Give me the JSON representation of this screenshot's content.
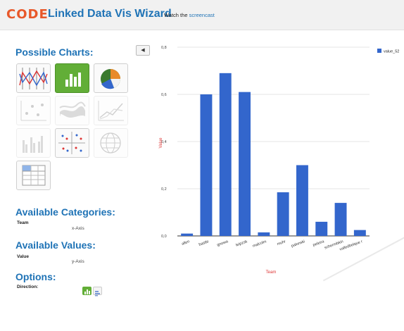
{
  "header": {
    "logo": "CODE",
    "title": "Linked Data Vis Wizard",
    "watch_prefix": "Watch the",
    "watch_link": "screencast"
  },
  "sidebar": {
    "possible_charts_title": "Possible Charts:",
    "collapse_icon": "chevron-left-icon",
    "chart_icons": [
      {
        "name": "parallel-coordinates-icon",
        "state": "enabled"
      },
      {
        "name": "bar-chart-icon",
        "state": "selected"
      },
      {
        "name": "pie-chart-icon",
        "state": "enabled"
      },
      {
        "name": "scatter-plot-icon",
        "state": "disabled"
      },
      {
        "name": "streamgraph-icon",
        "state": "disabled"
      },
      {
        "name": "line-chart-icon",
        "state": "disabled"
      },
      {
        "name": "grouped-bar-icon",
        "state": "disabled"
      },
      {
        "name": "scatter-matrix-icon",
        "state": "enabled"
      },
      {
        "name": "globe-map-icon",
        "state": "disabled"
      },
      {
        "name": "table-icon",
        "state": "enabled"
      }
    ],
    "categories_title": "Available Categories:",
    "category_name": "Team",
    "category_axis": "x-Axis",
    "values_title": "Available Values:",
    "value_name": "Value",
    "value_axis": "y-Axis",
    "options_title": "Options:",
    "direction_label": "Direction:"
  },
  "colors": {
    "accent": "#1f73b6",
    "logo": "#e8582a",
    "bar": "#3366cc",
    "selected_tile": "#62ae37",
    "axis_title": "#dd3333"
  },
  "chart_data": {
    "type": "bar",
    "categories": [
      "allen",
      "bastle",
      "gnowa",
      "leipzsk",
      "malcolm",
      "muhr",
      "palonski",
      "peleira",
      "schermbkin",
      "valledbelque r"
    ],
    "series": [
      {
        "name": "value_52",
        "values": [
          0.01,
          0.6,
          0.69,
          0.61,
          0.015,
          0.185,
          0.3,
          0.06,
          0.14,
          0.025
        ]
      }
    ],
    "xlabel": "Team",
    "ylabel": "Value",
    "ylim": [
      0,
      0.8
    ],
    "yticks": [
      "0,0",
      "0,2",
      "0,4",
      "0,6",
      "0,8"
    ],
    "grid": true,
    "legend": "top-right"
  }
}
